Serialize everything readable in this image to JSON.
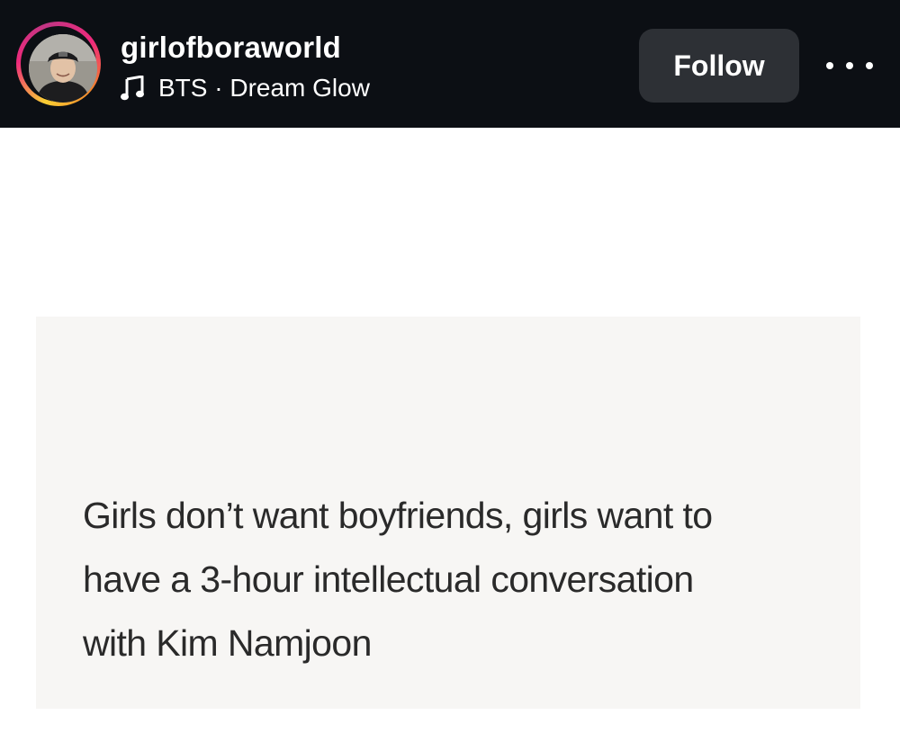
{
  "header": {
    "username": "girlofboraworld",
    "music": {
      "icon": "music-note-icon",
      "artist": "BTS",
      "separator": " · ",
      "song": "Dream Glow"
    },
    "follow_label": "Follow",
    "more_icon": "more-options-icon",
    "story_ring_colors": [
      "#f9ce34",
      "#ee2a7b",
      "#c13584",
      "#f58529"
    ]
  },
  "post": {
    "lines": [
      "Girls don’t want boyfriends, girls want to",
      "have a 3-hour intellectual conversation",
      "with Kim Namjoon"
    ]
  },
  "colors": {
    "header_bg": "#0c0f14",
    "follow_button_bg": "#2d3035",
    "text_dark": "#2a2a2a"
  }
}
